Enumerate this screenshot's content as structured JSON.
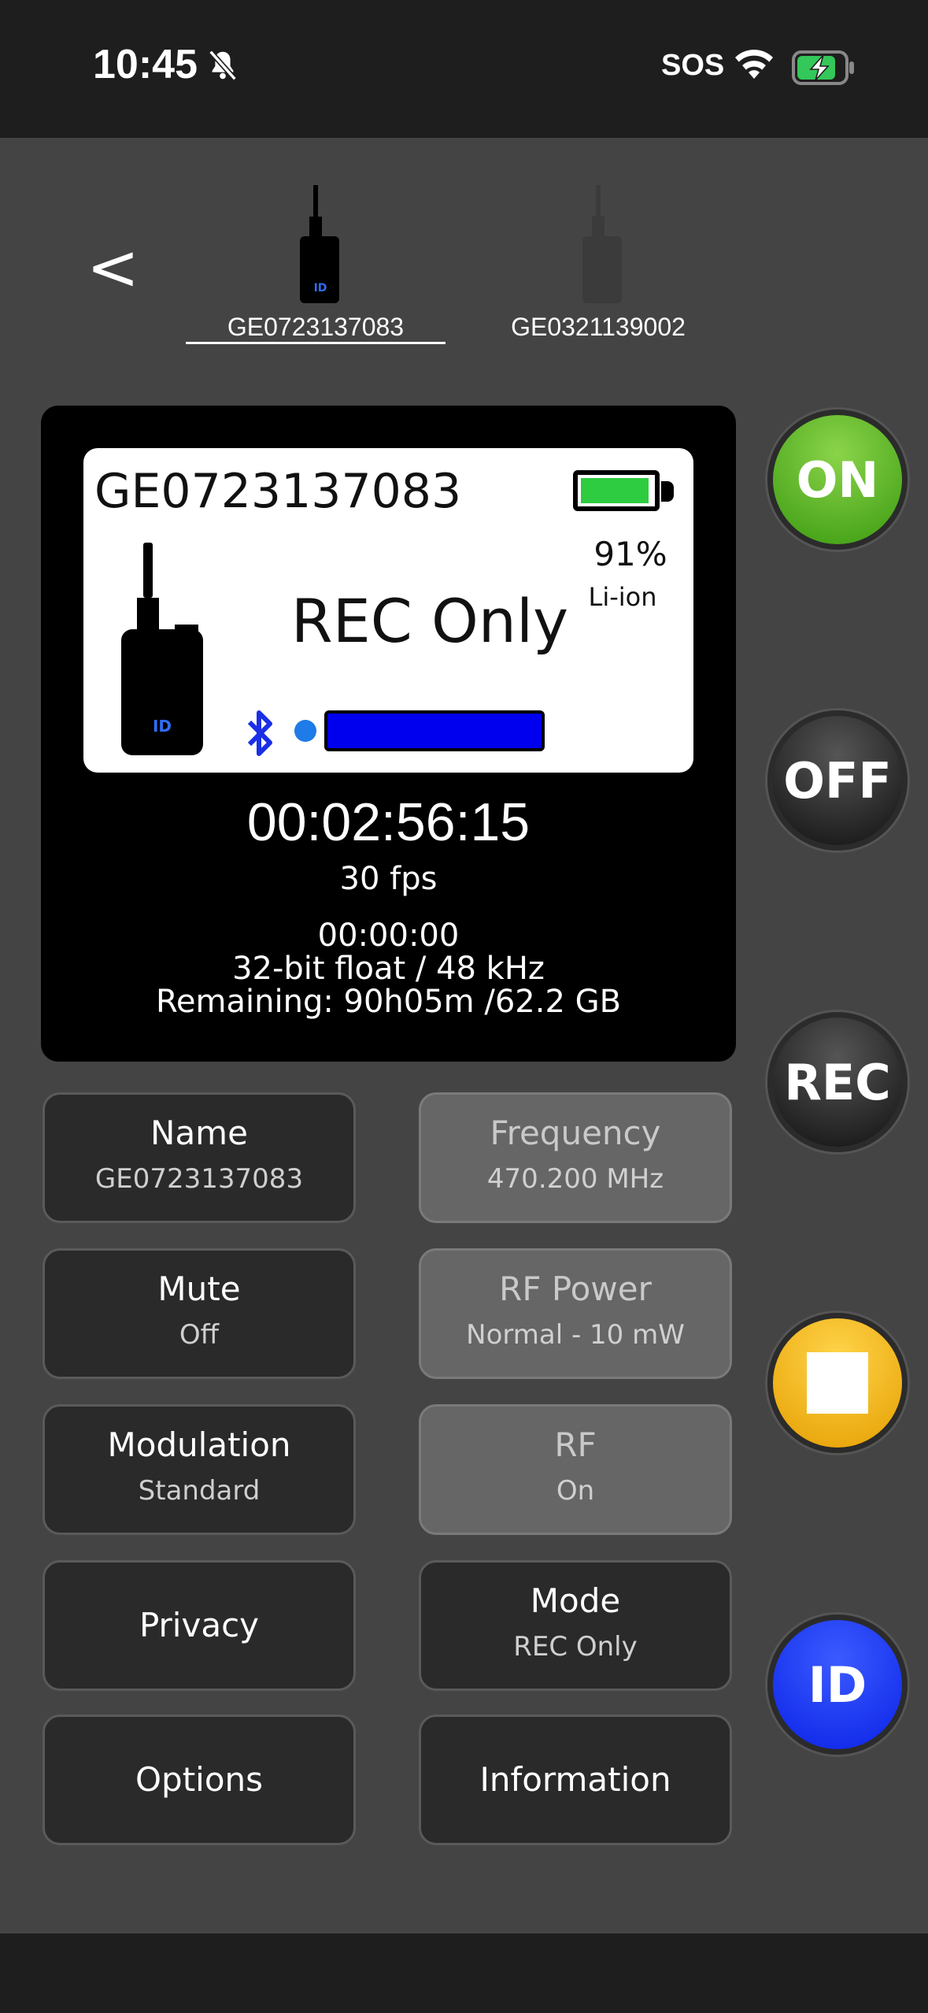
{
  "status_bar": {
    "time": "10:45",
    "carrier": "SOS",
    "icons": [
      "bell-slash-icon",
      "wifi-icon",
      "battery-charging-icon"
    ]
  },
  "nav": {
    "back_label": "<",
    "tabs": [
      {
        "label": "GE0723137083",
        "selected": true
      },
      {
        "label": "GE0321139002",
        "selected": false
      }
    ]
  },
  "display": {
    "device_name": "GE0723137083",
    "mode": "REC Only",
    "battery_percent_label": "91%",
    "battery_level": 0.91,
    "battery_type": "Li-ion",
    "device_badge": "ID",
    "timecode": "00:02:56:15",
    "fps": "30 fps",
    "sub_timecode": "00:00:00",
    "format": "32-bit float / 48 kHz",
    "remaining": "Remaining: 90h05m /62.2 GB"
  },
  "tiles": {
    "name": {
      "title": "Name",
      "value": "GE0723137083"
    },
    "frequency": {
      "title": "Frequency",
      "value": "470.200 MHz"
    },
    "mute": {
      "title": "Mute",
      "value": "Off"
    },
    "rf_power": {
      "title": "RF Power",
      "value": "Normal - 10 mW"
    },
    "modulation": {
      "title": "Modulation",
      "value": "Standard"
    },
    "rf": {
      "title": "RF",
      "value": "On"
    },
    "privacy": {
      "title": "Privacy"
    },
    "mode": {
      "title": "Mode",
      "value": "REC Only"
    },
    "options": {
      "title": "Options"
    },
    "information": {
      "title": "Information"
    }
  },
  "controls": {
    "on": "ON",
    "off": "OFF",
    "rec": "REC",
    "stop_icon": "stop-icon",
    "id": "ID"
  },
  "colors": {
    "on": "#5cb82a",
    "stop": "#f5b400",
    "id": "#1030f5",
    "meter": "#0000ee",
    "battery_fill": "#2ecc40"
  }
}
